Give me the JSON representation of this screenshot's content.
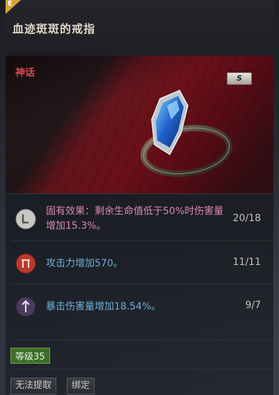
{
  "item": {
    "grade_letter": "E",
    "name": "血迹斑斑的戒指",
    "rarity": "神话",
    "slot_badge": "S"
  },
  "stats": [
    {
      "text": "固有效果：剩余生命值低于50%时伤害量增加15.3%。",
      "count": "20/18",
      "color": "#d98ab0",
      "icon": "pale-rune-icon"
    },
    {
      "text": "攻击力增加570。",
      "count": "11/11",
      "color": "#6fb0d8",
      "icon": "red-gate-icon"
    },
    {
      "text": "暴击伤害量增加18.54%。",
      "count": "9/7",
      "color": "#6fb0d8",
      "icon": "purple-arrow-icon"
    }
  ],
  "footer": {
    "level": "等级35",
    "untradable_label": "无法提取",
    "bound_label": "绑定"
  },
  "colors": {
    "rarity": "#e04848",
    "level_badge": "#3f6e2b"
  }
}
